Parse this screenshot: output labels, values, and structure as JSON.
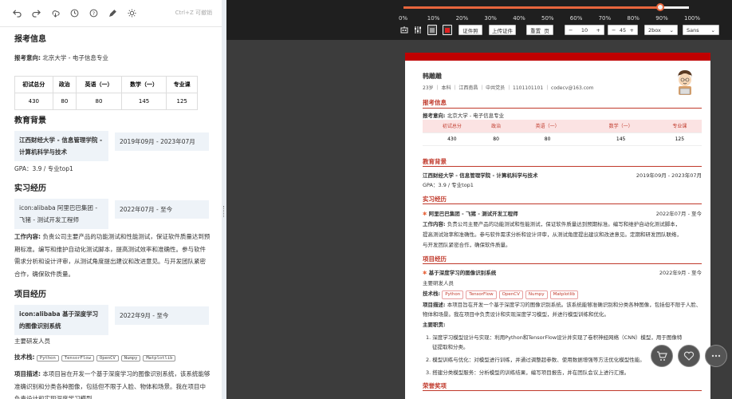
{
  "toolbar": {
    "hint": "Ctrl+Z 可撤销"
  },
  "editor": {
    "h_apply": "报考信息",
    "apply_line_label": "报考意向:",
    "apply_line_value": "北京大学 - 电子信息专业",
    "score_headers": [
      "初试总分",
      "政治",
      "英语（一）",
      "数学（一）",
      "专业课"
    ],
    "score_values": [
      "430",
      "80",
      "80",
      "145",
      "125"
    ],
    "h_edu": "教育背景",
    "edu_school": "江西财经大学 - 信息管理学院 - 计算机科学与技术",
    "edu_date": "2019年09月 - 2023年07月",
    "edu_gpa": "GPA：3.9 / 专业top1",
    "h_intern": "实习经历",
    "intern_company": "icon:alibaba 阿里巴巴集团 - 飞猪 - 测试开发工程师",
    "intern_date": "2022年07月 - 至今",
    "intern_label": "工作内容:",
    "intern_text": "负责公司主要产品的功能测试和性能测试，保证软件质量达到预期标准。编写和维护自动化测试脚本，提高测试效率和准确性。参与软件需求分析和设计评审，从测试角度提出建议和改进意见。与开发团队紧密合作，确保软件质量。",
    "h_proj": "项目经历",
    "proj_name": "icon:alibaba 基于深度学习的图像识别系统",
    "proj_date": "2022年9月 - 至今",
    "proj_role": "主要研发人员",
    "tech_label": "技术栈:",
    "tech": [
      "Python",
      "TensorFlow",
      "OpenCV",
      "Numpy",
      "Matplotlib"
    ],
    "proj_desc_label": "项目描述:",
    "proj_desc": "本项目旨在开发一个基于深度学习的图像识别系统，该系统能够准确识别和分类各种图像，包括但不限于人脸、物体和场景。我在项目中负责设计和实现深度学习模型"
  },
  "zoom": {
    "value": 0.9,
    "ticks": [
      "0%",
      "10%",
      "20%",
      "30%",
      "40%",
      "50%",
      "60%",
      "70%",
      "80%",
      "90%",
      "100%"
    ]
  },
  "controls": {
    "import": "证件照",
    "upload": "上传证件",
    "reset": "重置",
    "page": "页",
    "font_size": "10",
    "line_height": "45",
    "zoom_select": "2box",
    "font": "Sans"
  },
  "resume": {
    "name": "韩雕雕",
    "info": [
      "23岁",
      "本科",
      "江西南昌",
      "中共党员",
      "1101101101",
      "codecv@163.com"
    ],
    "h_apply": "报考信息",
    "apply_label": "报考意向:",
    "apply_value": "北京大学 - 电子信息专业",
    "score_headers": [
      "初试总分",
      "政治",
      "英语（一）",
      "数学（一）",
      "专业课"
    ],
    "score_values": [
      "430",
      "80",
      "80",
      "145",
      "125"
    ],
    "h_edu": "教育背景",
    "edu_school": "江西财经大学 - 信息管理学院 - 计算机科学与技术",
    "edu_date": "2019年09月 - 2023年07月",
    "edu_gpa": "GPA：3.9 / 专业top1",
    "h_intern": "实习经历",
    "intern_company": "阿里巴巴集团 - 飞猪 - 测试开发工程师",
    "intern_date": "2022年07月 - 至今",
    "intern_label": "工作内容:",
    "intern_text1": "负责公司主要产品的功能测试和性能测试，保证软件质量达到预期标准。编写和维护自动化测试脚本，",
    "intern_text2": "提高测试效率和准确性。参与软件需求分析和设计评审，从测试角度提出建议和改进意见。定期和研发团队联络，",
    "intern_text3": "与开发团队紧密合作，确保软件质量。",
    "h_proj": "项目经历",
    "proj_name": "基于深度学习的图像识别系统",
    "proj_date": "2022年9月 - 至今",
    "proj_role": "主要研发人员",
    "tech_label": "技术栈:",
    "tech": [
      "Python",
      "TensorFlow",
      "OpenCV",
      "Numpy",
      "Matplotlib"
    ],
    "proj_desc_label": "项目描述:",
    "proj_desc1": "本项目旨在开发一个基于深度学习的图像识别系统。该系统能够准确识别和分类各种图像，包括但不限于人脸、",
    "proj_desc2": "物体和场景。我在项目中负责设计和实现深度学习模型，并进行模型训练和优化。",
    "contrib_label": "主要职责:",
    "contrib": [
      "深度学习模型设计与实现：利用Python和TensorFlow设计并实现了卷积神经网络（CNN）模型，用于图像特",
      "模型训练与优化：对模型进行训练，并通过调整超参数、使用数据增强等方法优化模型性能。",
      "搭建分类模型服务：分析模型的训练结果，编写项目报告，并在团队会议上进行汇报。"
    ],
    "contrib_cont": "征提取和分类。",
    "h_award": "荣誉奖项"
  },
  "colors": {
    "accent": "#c0392b",
    "slider": "#e8663d"
  }
}
